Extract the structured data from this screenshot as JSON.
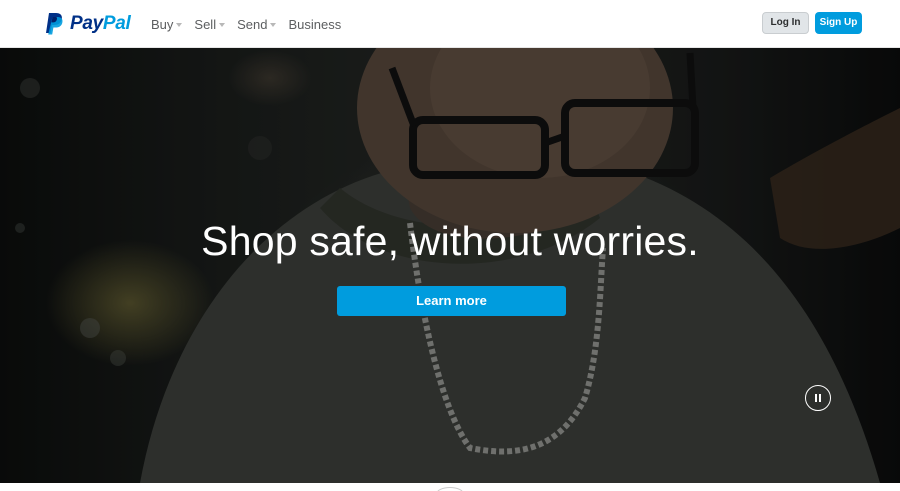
{
  "brand": {
    "name_part1": "Pay",
    "name_part2": "Pal"
  },
  "nav": [
    {
      "label": "Buy",
      "has_dropdown": true
    },
    {
      "label": "Sell",
      "has_dropdown": true
    },
    {
      "label": "Send",
      "has_dropdown": true
    },
    {
      "label": "Business",
      "has_dropdown": false
    }
  ],
  "header_actions": {
    "login_label": "Log In",
    "signup_label": "Sign Up"
  },
  "hero": {
    "title": "Shop safe, without worries.",
    "cta_label": "Learn more"
  },
  "colors": {
    "brand_dark": "#003087",
    "brand_light": "#009cde",
    "button_primary": "#009cde",
    "button_secondary": "#e1e5e8"
  }
}
